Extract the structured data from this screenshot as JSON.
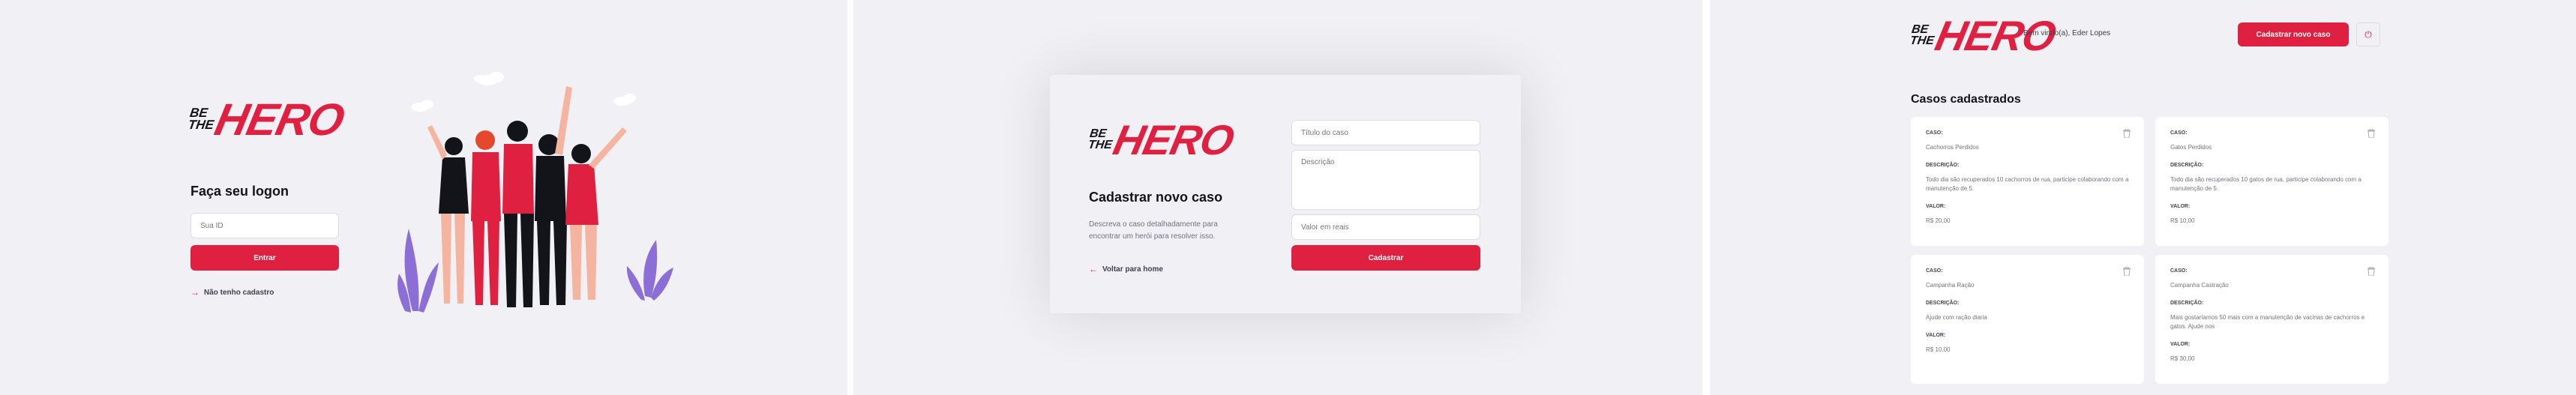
{
  "logo": {
    "line1": "BE",
    "line2": "THE",
    "word": "HERO"
  },
  "logon": {
    "title": "Faça seu logon",
    "id_placeholder": "Sua ID",
    "submit": "Entrar",
    "register_link": "Não tenho cadastro"
  },
  "new_case": {
    "title": "Cadastrar novo caso",
    "description": "Descreva o caso detalhadamente para encontrar um herói para resolver isso.",
    "back_link": "Voltar para home",
    "title_placeholder": "Título do caso",
    "description_placeholder": "Descrição",
    "value_placeholder": "Valor em reais",
    "submit": "Cadastrar"
  },
  "profile": {
    "welcome": "Bem vindo(a), Eder Lopes",
    "new_case_button": "Cadastrar novo caso",
    "cases_title": "Casos cadastrados",
    "labels": {
      "case": "CASO:",
      "description": "DESCRIÇÃO:",
      "value": "VALOR:"
    },
    "cases": [
      {
        "title": "Cachorros Perdidos",
        "description": "Todo dia são recuperados 10 cachorros de rua, participe colaborando com a manutenção de 5.",
        "value": "R$ 20,00"
      },
      {
        "title": "Gatos Perdidos",
        "description": "Todo dia são recuperados 10 gatos de rua, participe colaborando com a manutenção de 5.",
        "value": "R$ 10,00"
      },
      {
        "title": "Campanha Ração",
        "description": "Ajude com ração diaria",
        "value": "R$ 10,00"
      },
      {
        "title": "Campanha Castração",
        "description": "Mais gostaríamos 50 mais com a manutenção de vacinas de cachorros e gatos. Ajude nos",
        "value": "R$ 30,00"
      }
    ]
  },
  "colors": {
    "accent": "#e02041",
    "background": "#f0f0f5",
    "text": "#13131a",
    "muted": "#737380"
  },
  "icons": {
    "back": "arrow-left-icon",
    "logout": "power-icon",
    "delete": "trash-icon"
  }
}
